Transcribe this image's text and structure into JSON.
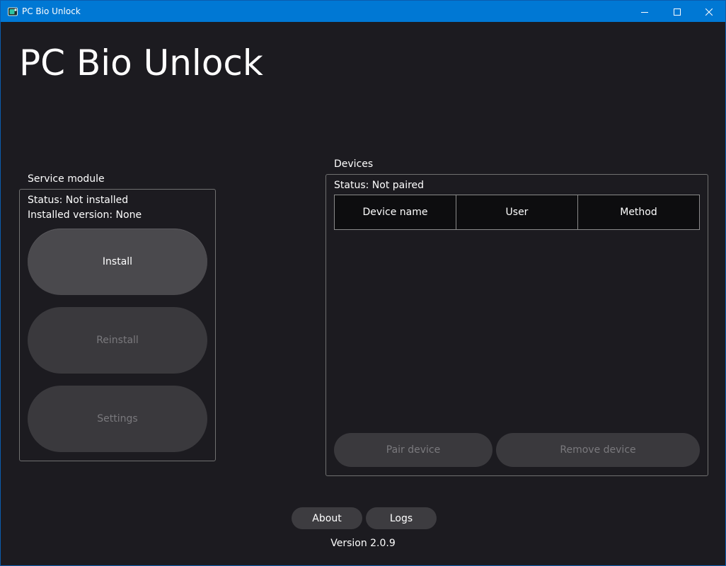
{
  "window": {
    "title": "PC Bio Unlock",
    "titlebar_color": "#0078d4",
    "controls": [
      "minimize-icon",
      "maximize-icon",
      "close-icon"
    ]
  },
  "app_title": "PC Bio Unlock",
  "service_module": {
    "label": "Service module",
    "status": "Status: Not installed",
    "installed_version": "Installed version: None",
    "buttons": {
      "install": "Install",
      "reinstall": "Reinstall",
      "settings": "Settings"
    }
  },
  "devices": {
    "label": "Devices",
    "status": "Status: Not paired",
    "columns": [
      "Device name",
      "User",
      "Method"
    ],
    "rows": [],
    "buttons": {
      "pair": "Pair device",
      "remove": "Remove device"
    }
  },
  "footer": {
    "about": "About",
    "logs": "Logs",
    "version": "Version 2.0.9"
  }
}
